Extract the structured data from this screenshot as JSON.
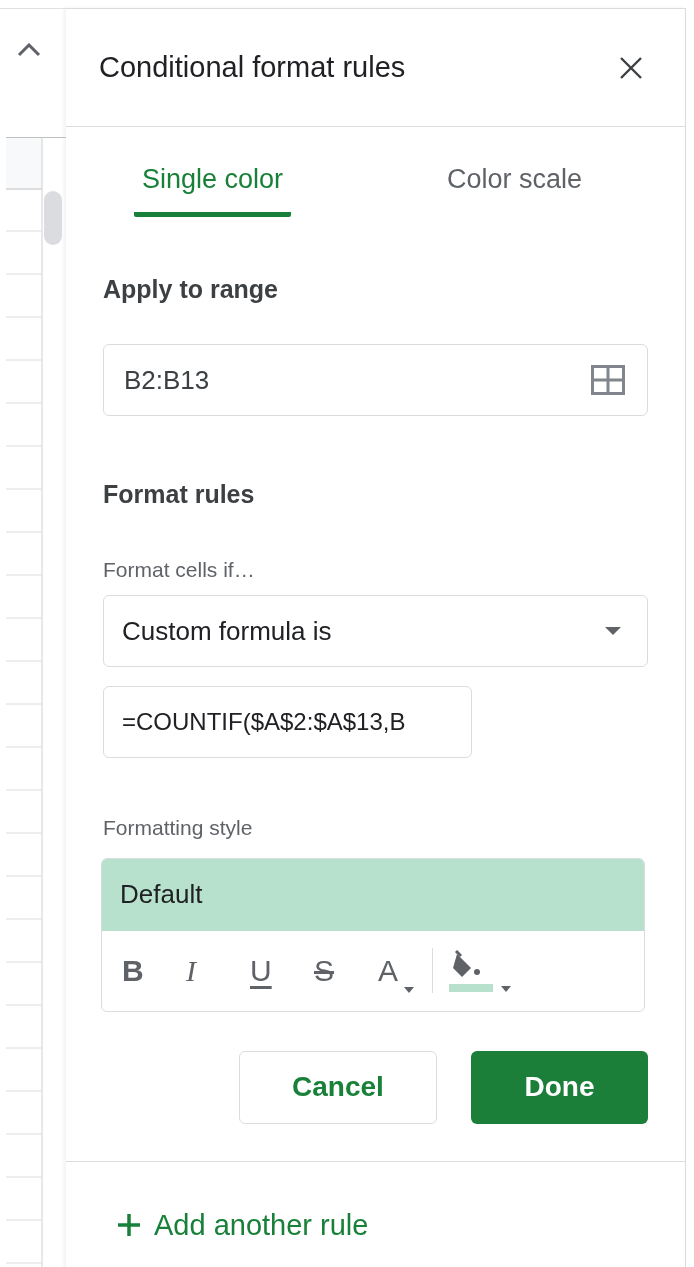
{
  "panel": {
    "title": "Conditional format rules"
  },
  "tabs": [
    {
      "label": "Single color",
      "selected": true
    },
    {
      "label": "Color scale",
      "selected": false
    }
  ],
  "range": {
    "heading": "Apply to range",
    "value": "B2:B13"
  },
  "format_rules": {
    "heading": "Format rules",
    "condition_label": "Format cells if…",
    "condition": "Custom formula is",
    "formula": "=COUNTIF($A$2:$A$13,B"
  },
  "formatting_style": {
    "label": "Formatting style",
    "preview": "Default",
    "toolbar": [
      {
        "kind": "bold",
        "label": "B"
      },
      {
        "kind": "italic",
        "label": "I"
      },
      {
        "kind": "underline",
        "label": "U"
      },
      {
        "kind": "strikethrough",
        "label": "S"
      },
      {
        "kind": "text_color",
        "label": "A"
      },
      {
        "kind": "fill_color",
        "color": "#b7e1cd"
      }
    ]
  },
  "buttons": [
    {
      "label": "Cancel",
      "kind": "secondary"
    },
    {
      "label": "Done",
      "kind": "primary"
    }
  ],
  "add_rule": {
    "label": "Add another rule"
  }
}
